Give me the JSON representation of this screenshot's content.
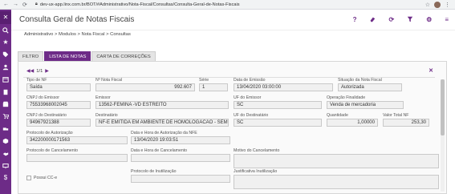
{
  "browser": {
    "url": "dev-ux-app.linx.com.br/BOT/#Administrativo/Nota-Fiscal/Consultas/Consulta-Geral-de-Notas-Fiscais"
  },
  "header": {
    "title": "Consulta Geral de Notas Fiscais",
    "help": "?"
  },
  "breadcrumb": "Administrativo  >  Modulos  >  Nota Fiscal  >  Consultas",
  "tabs": [
    {
      "label": "FILTRO",
      "active": false
    },
    {
      "label": "LISTA DE NOTAS",
      "active": true
    },
    {
      "label": "CARTA DE CORREÇÕES",
      "active": false
    }
  ],
  "pager": {
    "text": "1/1"
  },
  "fields": {
    "tipo_nf": {
      "label": "Tipo de NF",
      "value": "Saída"
    },
    "numero_nf": {
      "label": "Nº Nota Fiscal",
      "value": "992.607"
    },
    "serie": {
      "label": "Série",
      "value": "1"
    },
    "data_emissao": {
      "label": "Data de Emissão",
      "value": "13/04/2020 03:00:00"
    },
    "situacao": {
      "label": "Situação da Nota Fiscal",
      "value": "Autorizada"
    },
    "cnpj_emissor": {
      "label": "CNPJ do Emissor",
      "value": "75533968002045"
    },
    "emissor": {
      "label": "Emissor",
      "value": "13562-FEMINA -VD ESTREITO"
    },
    "uf_emissor": {
      "label": "UF do Emissor",
      "value": "SC"
    },
    "operacao": {
      "label": "Operação Finalidade",
      "value": "Venda de mercadoria"
    },
    "cnpj_destinatario": {
      "label": "CNPJ do Destinatário",
      "value": "94967921388"
    },
    "destinatario": {
      "label": "Destinatário",
      "value": "NF-E EMITIDA EM AMBIENTE DE HOMOLOGACAO - SEM ..."
    },
    "uf_destinatario": {
      "label": "UF do Destinatário",
      "value": "SC"
    },
    "quantidade": {
      "label": "Quantidade",
      "value": "1,00000"
    },
    "valor_total": {
      "label": "Valor Total NF",
      "value": "253,30"
    },
    "protocolo_autorizacao": {
      "label": "Protocolo de Autorização",
      "value": "342200000171563"
    },
    "data_autorizacao": {
      "label": "Data e Hora de Autorização da NFE",
      "value": "13/04/2020 19:03:51"
    },
    "protocolo_cancelamento": {
      "label": "Protocolo de Cancelamento",
      "value": ""
    },
    "data_cancelamento": {
      "label": "Data e Hora de Cancelamento",
      "value": ""
    },
    "motivo_cancelamento": {
      "label": "Motivo do Cancelamento",
      "value": ""
    },
    "protocolo_inutilizacao": {
      "label": "Protocolo de Inutilização",
      "value": ""
    },
    "justificativa_inutilizacao": {
      "label": "Justificativa Inutilização",
      "value": ""
    }
  },
  "checkbox": {
    "label": "Possui CC-e",
    "checked": false
  },
  "colors": {
    "accent": "#6d2b87"
  }
}
